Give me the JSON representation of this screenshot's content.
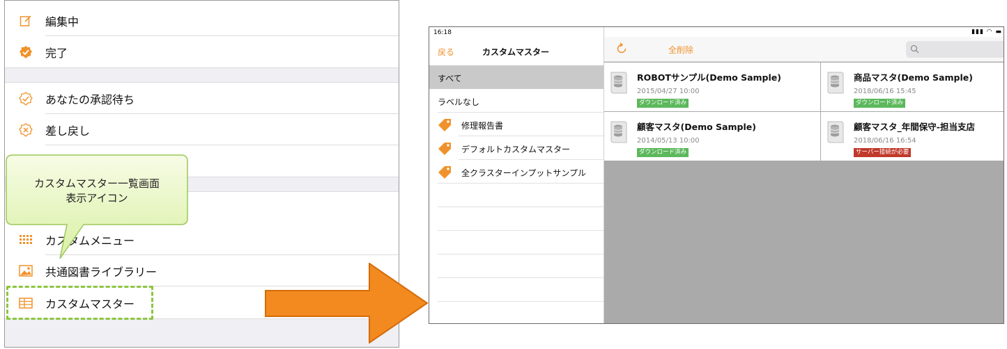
{
  "left_menu": {
    "items": [
      {
        "label": "編集中",
        "icon": "edit-icon"
      },
      {
        "label": "完了",
        "icon": "check-badge-icon"
      },
      {
        "label": "あなたの承認待ち",
        "icon": "approval-pending-icon"
      },
      {
        "label": "差し戻し",
        "icon": "rejected-icon"
      },
      {
        "label": "カスタムメニュー",
        "icon": "grid-dots-icon"
      },
      {
        "label": "共通図書ライブラリー",
        "icon": "image-icon"
      },
      {
        "label": "カスタムマスター",
        "icon": "table-icon"
      }
    ],
    "accent_color": "#f0922b"
  },
  "callout": {
    "text": "カスタムマスター一覧画面\n表示アイコン"
  },
  "app": {
    "status_bar": {
      "time": "16:18",
      "icons": "signal-wifi-battery"
    },
    "sidebar": {
      "back_label": "戻る",
      "title": "カスタムマスター",
      "items": [
        {
          "label": "すべて",
          "selected": true
        },
        {
          "label": "ラベルなし"
        },
        {
          "label": "修理報告書",
          "icon": "tag-icon"
        },
        {
          "label": "デフォルトカスタムマスター",
          "icon": "tag-icon"
        },
        {
          "label": "全クラスターインプットサンプル",
          "icon": "tag-icon"
        }
      ]
    },
    "toolbar": {
      "refresh_icon": "refresh-icon",
      "delete_all_label": "全削除",
      "search_icon": "search-icon"
    },
    "masters": [
      {
        "title": "ROBOTサンプル(Demo Sample)",
        "date": "2015/04/27 10:00",
        "badge": "ダウンロード済み",
        "badge_color": "#5cb85c"
      },
      {
        "title": "商品マスタ(Demo Sample)",
        "date": "2018/06/16 15:45",
        "badge": "ダウンロード済み",
        "badge_color": "#5cb85c"
      },
      {
        "title": "顧客マスタ(Demo Sample)",
        "date": "2014/05/13 10:00",
        "badge": "ダウンロード済み",
        "badge_color": "#5cb85c"
      },
      {
        "title": "顧客マスタ_年間保守-担当支店",
        "date": "2018/06/16 16:54",
        "badge": "サーバー接続が必要",
        "badge_color": "#c0392b"
      }
    ]
  }
}
